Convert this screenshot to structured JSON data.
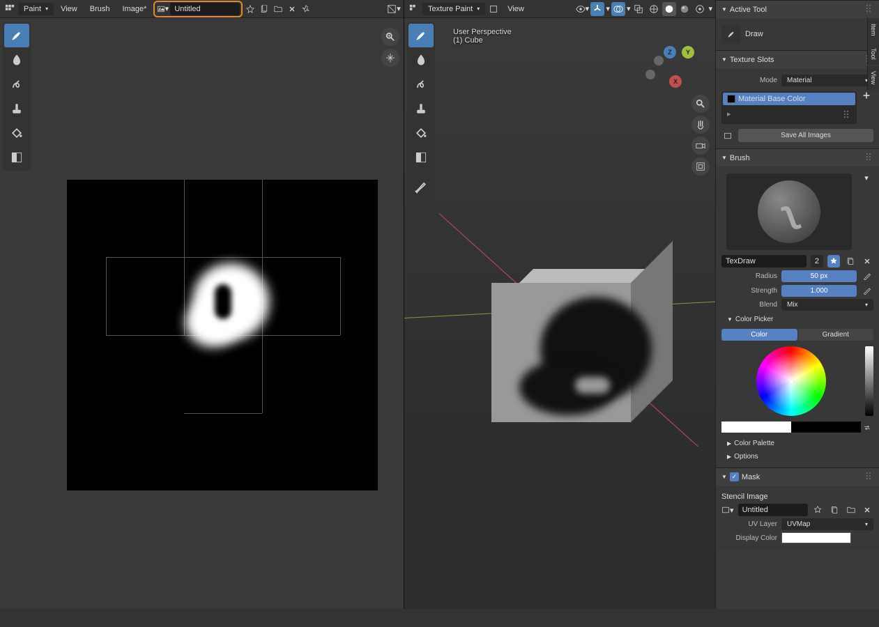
{
  "left_header": {
    "mode": "Paint",
    "menus": [
      "View",
      "Brush",
      "Image*"
    ],
    "image_name": "Untitled"
  },
  "right_header": {
    "mode": "Texture Paint",
    "menus": [
      "View"
    ]
  },
  "overlay": {
    "perspective": "User Perspective",
    "object": "(1) Cube"
  },
  "sidebar": {
    "active_tool": {
      "title": "Active Tool",
      "tool": "Draw"
    },
    "texture_slots": {
      "title": "Texture Slots",
      "mode_label": "Mode",
      "mode_value": "Material",
      "slot": "Material Base Color",
      "save_btn": "Save All Images"
    },
    "brush": {
      "title": "Brush",
      "name": "TexDraw",
      "users": "2",
      "radius_label": "Radius",
      "radius_value": "50 px",
      "strength_label": "Strength",
      "strength_value": "1.000",
      "blend_label": "Blend",
      "blend_value": "Mix",
      "color_picker": "Color Picker",
      "tab_color": "Color",
      "tab_gradient": "Gradient",
      "palette": "Color Palette",
      "options": "Options"
    },
    "mask": {
      "title": "Mask",
      "stencil": "Stencil Image",
      "image": "Untitled",
      "uv_label": "UV Layer",
      "uv_value": "UVMap",
      "display_label": "Display Color"
    }
  },
  "side_tabs": [
    "Item",
    "Tool",
    "View"
  ],
  "gizmo": {
    "x": "X",
    "y": "Y",
    "z": "Z"
  }
}
